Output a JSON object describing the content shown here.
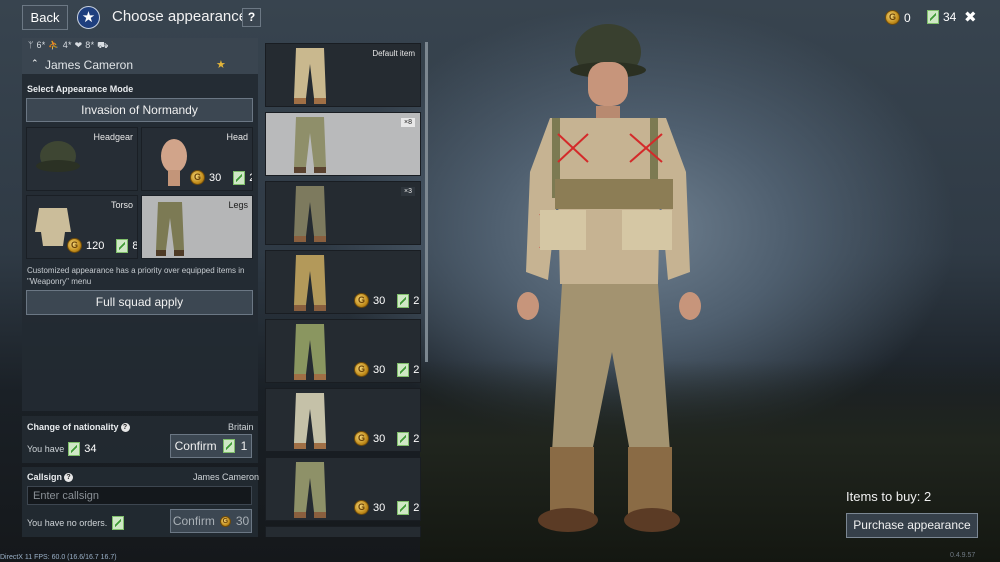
{
  "header": {
    "back_label": "Back",
    "title": "Choose appearance",
    "help_label": "?",
    "gold_amount": "0",
    "tickets_amount": "34",
    "close_label": "✖"
  },
  "soldier": {
    "stats": "ᛘ 6* ⛹ 4* ❤ 8* ⛟",
    "name": "James Cameron",
    "expand_icon": "chevron-up-icon",
    "rank_icon": "star-icon"
  },
  "appearance_mode": {
    "label": "Select Appearance Mode",
    "value": "Invasion of Normandy"
  },
  "slots": [
    {
      "label": "Headgear"
    },
    {
      "label": "Head",
      "gold": "30",
      "tickets": "2"
    },
    {
      "label": "Torso",
      "gold": "120",
      "tickets": "8"
    },
    {
      "label": "Legs"
    }
  ],
  "note": "Customized appearance has a priority over equipped items in \"Weaponry\" menu",
  "full_squad_label": "Full squad apply",
  "nationality": {
    "title": "Change of nationality",
    "country": "Britain",
    "you_have_label": "You have",
    "you_have_amount": "34",
    "confirm_label": "Confirm",
    "confirm_cost": "1"
  },
  "callsign": {
    "title": "Callsign",
    "current": "James Cameron",
    "placeholder": "Enter callsign",
    "no_orders": "You have no orders.",
    "confirm_label": "Confirm",
    "confirm_cost": "30"
  },
  "items": [
    {
      "label": "Default item",
      "color": "#c9b88e"
    },
    {
      "badge": "×8",
      "color": "#8f8f6a"
    },
    {
      "badge": "×3",
      "color": "#7d7a5e"
    },
    {
      "gold": "30",
      "tickets": "2",
      "color": "#b3995a"
    },
    {
      "gold": "30",
      "tickets": "2",
      "color": "#8a9660"
    },
    {
      "gold": "30",
      "tickets": "2",
      "color": "#c5c1a8"
    },
    {
      "gold": "30",
      "tickets": "2",
      "color": "#8e9168"
    }
  ],
  "items_to_buy": "Items to buy: 2",
  "purchase_label": "Purchase appearance",
  "debug_text": "DirectX 11 FPS: 60.0 (16.6/16.7 16.7)",
  "version_text": "0.4.9.57"
}
